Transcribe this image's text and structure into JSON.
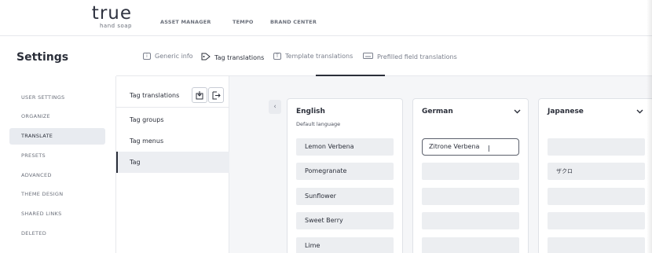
{
  "brand": {
    "logo_main": "true",
    "logo_sub": "hand soap"
  },
  "topnav": [
    "ASSET MANAGER",
    "TEMPO",
    "BRAND CENTER"
  ],
  "settings_title": "Settings",
  "tabs": [
    {
      "label": "Generic info",
      "icon": "info-icon"
    },
    {
      "label": "Tag translations",
      "icon": "tag-icon"
    },
    {
      "label": "Template translations",
      "icon": "template-icon"
    },
    {
      "label": "Prefilled field translations",
      "icon": "keyboard-icon"
    }
  ],
  "sidebar": [
    {
      "label": "USER SETTINGS"
    },
    {
      "label": "ORGANIZE"
    },
    {
      "label": "TRANSLATE"
    },
    {
      "label": "PRESETS"
    },
    {
      "label": "ADVANCED"
    },
    {
      "label": "THEME DESIGN"
    },
    {
      "label": "SHARED LINKS"
    },
    {
      "label": "DELETED"
    }
  ],
  "middle": {
    "header": "Tag translations",
    "items": [
      "Tag groups",
      "Tag menus",
      "Tag"
    ]
  },
  "columns": [
    {
      "language": "English",
      "subtitle": "Default language",
      "values": [
        "Lemon Verbena",
        "Pomegranate",
        "Sunflower",
        "Sweet Berry",
        "Lime"
      ]
    },
    {
      "language": "German",
      "values": [
        "Zitrone Verbena",
        "",
        "",
        "",
        ""
      ]
    },
    {
      "language": "Japanese",
      "values": [
        "",
        "ザクロ",
        "",
        "",
        ""
      ]
    }
  ],
  "colors": {
    "active_bg": "#e8ebf0",
    "content_bg": "#f5f6f8",
    "text": "#2b2f3a"
  }
}
